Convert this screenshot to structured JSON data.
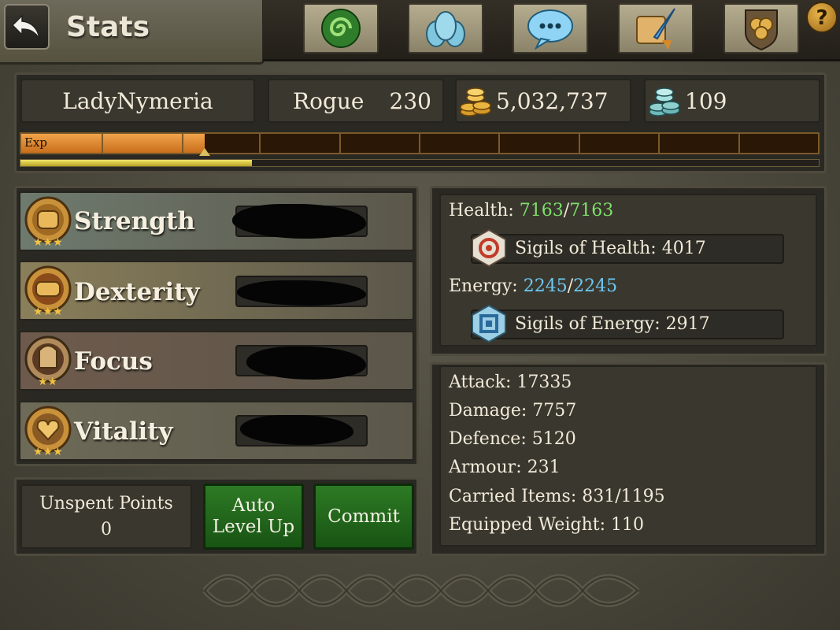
{
  "header": {
    "title": "Stats"
  },
  "tabs": [
    {
      "icon": "swirl-icon"
    },
    {
      "icon": "guild-statues-icon"
    },
    {
      "icon": "chat-bubble-icon"
    },
    {
      "icon": "scroll-quill-icon"
    },
    {
      "icon": "shield-emblem-icon"
    }
  ],
  "character": {
    "name": "LadyNymeria",
    "class": "Rogue",
    "level": "230",
    "gold": "5,032,737",
    "platinum": "109",
    "exp_label": "Exp",
    "exp_progress": 0.23,
    "sub_progress": 0.29
  },
  "attributes": [
    {
      "label": "Strength",
      "icon": "strength-fist-icon",
      "row_color": "#6e7a6e",
      "value": "",
      "redacted": true
    },
    {
      "label": "Dexterity",
      "icon": "dexterity-fist-icon",
      "row_color": "#8a7f5a",
      "value": "",
      "redacted": true
    },
    {
      "label": "Focus",
      "icon": "focus-helmet-icon",
      "row_color": "#6e5a4c",
      "value": "",
      "redacted": true
    },
    {
      "label": "Vitality",
      "icon": "vitality-heart-icon",
      "row_color": "#6e6a58",
      "value": "",
      "redacted": true
    }
  ],
  "actions": {
    "unspent_label": "Unspent Points",
    "unspent_value": "0",
    "auto_level_line1": "Auto",
    "auto_level_line2": "Level Up",
    "commit": "Commit"
  },
  "resources": {
    "health_label": "Health:",
    "health_current": "7163",
    "health_max": "7163",
    "sigils_health": "Sigils of Health: 4017",
    "energy_label": "Energy:",
    "energy_current": "2245",
    "energy_max": "2245",
    "sigils_energy": "Sigils of Energy: 2917",
    "health_color": "#7ee06a",
    "energy_color": "#6cc9f0"
  },
  "stats": [
    "Attack: 17335",
    "Damage: 7757",
    "Defence: 5120",
    "Armour: 231",
    "Carried Items: 831/1195",
    "Equipped Weight: 110"
  ]
}
